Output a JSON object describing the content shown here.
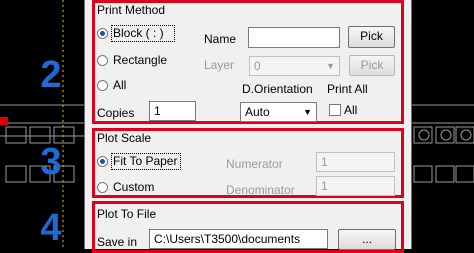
{
  "steps": [
    "2",
    "3",
    "4"
  ],
  "print_method": {
    "title": "Print Method",
    "block_label": "Block ( : )",
    "rectangle_label": "Rectangle",
    "all_label": "All",
    "name_label": "Name",
    "name_value": "",
    "pick_label": "Pick",
    "layer_label": "Layer",
    "layer_value": "0",
    "layer_pick_label": "Pick",
    "orientation_label": "D.Orientation",
    "orientation_value": "Auto",
    "print_all_label": "Print All",
    "print_all_check_label": "All",
    "copies_label": "Copies",
    "copies_value": "1"
  },
  "plot_scale": {
    "title": "Plot Scale",
    "fit_label": "Fit To Paper",
    "custom_label": "Custom",
    "numerator_label": "Numerator",
    "numerator_value": "1",
    "denominator_label": "Denominator",
    "denominator_value": "1"
  },
  "plot_to_file": {
    "title": "Plot To File",
    "save_in_label": "Save in",
    "save_in_value": "C:\\Users\\T3500\\documents",
    "browse_label": "..."
  },
  "colors": {
    "highlight": "#e0001a",
    "step_number": "#1e6bd6"
  }
}
